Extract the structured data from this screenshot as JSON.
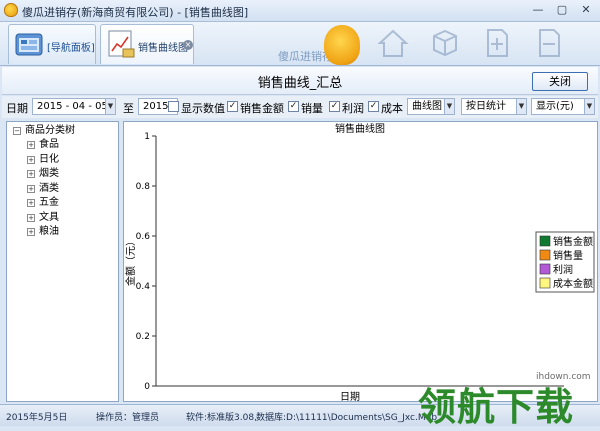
{
  "window": {
    "title": "傻瓜进销存(新海商贸有限公司) - [销售曲线图]",
    "minimize": "—",
    "maximize": "▢",
    "close": "✕"
  },
  "ribbon": {
    "tabs": [
      {
        "label": "[导航面板]"
      },
      {
        "label": "销售曲线图",
        "close": "×"
      }
    ],
    "brand_text": "傻瓜进销存"
  },
  "page": {
    "title": "销售曲线_汇总",
    "close_button": "关闭"
  },
  "filter": {
    "date_label": "日期",
    "date_from": "2015 - 04 - 05",
    "to_label": "至",
    "date_to": "2015",
    "show_value_label": "显示数值",
    "show_value_checked": false,
    "sales_amount_label": "销售金额",
    "sales_amount_checked": true,
    "sales_qty_label": "销量",
    "sales_qty_checked": true,
    "profit_label": "利润",
    "profit_checked": true,
    "cost_label": "成本",
    "cost_checked": true,
    "chart_type": "曲线图",
    "period": "按日统计",
    "display_unit": "显示(元)"
  },
  "tree": {
    "root": "商品分类树",
    "items": [
      "食品",
      "日化",
      "烟类",
      "酒类",
      "五金",
      "文具",
      "粮油"
    ]
  },
  "chart_data": {
    "type": "line",
    "title": "销售曲线图",
    "xlabel": "日期",
    "ylabel": "金额（元）",
    "ylim": [
      0,
      1
    ],
    "y_ticks": [
      "0",
      "0.2",
      "0.4",
      "0.6",
      "0.8",
      "1"
    ],
    "grid": false,
    "legend_position": "right",
    "series": [
      {
        "name": "销售金额",
        "color": "#0f7a2f",
        "values": []
      },
      {
        "name": "销售量",
        "color": "#f08a12",
        "values": []
      },
      {
        "name": "利润",
        "color": "#b35ad6",
        "values": []
      },
      {
        "name": "成本金额",
        "color": "#fff680",
        "values": []
      }
    ]
  },
  "status": {
    "date": "2015年5月5日",
    "operator": "操作员：管理员",
    "version": "软件:标准版3.08,",
    "database": "数据库:D:\\11111\\Documents\\SG_Jxc.Mdb"
  },
  "watermark": {
    "site": "ihdown.com",
    "text": "领航下载"
  }
}
